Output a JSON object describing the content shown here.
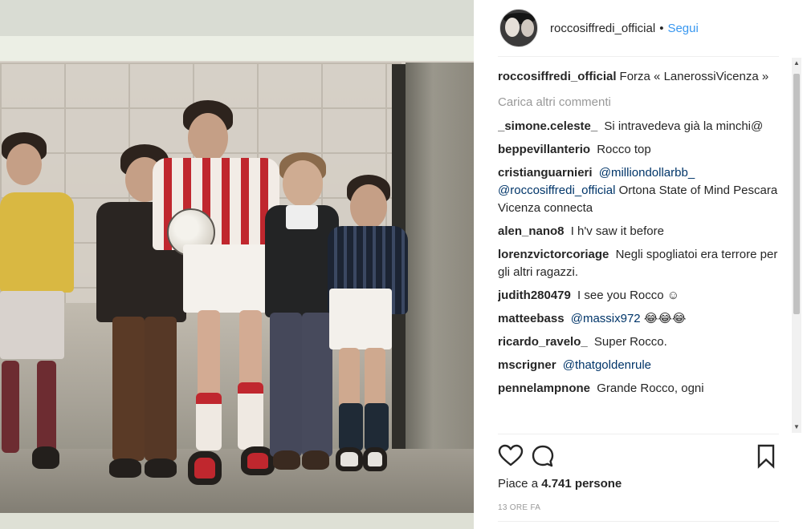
{
  "post": {
    "username": "roccosiffredi_official",
    "separator": "•",
    "follow_label": "Segui",
    "caption": {
      "user": "roccosiffredi_official",
      "text": "Forza « LanerossiVicenza »"
    },
    "load_more_label": "Carica altri commenti",
    "comments": [
      {
        "user": "_simone.celeste_",
        "text": "Si intravedeva già la minchi@"
      },
      {
        "user": "beppevillanterio",
        "text": "Rocco top"
      },
      {
        "user": "cristianguarnieri",
        "mention1": "@milliondollarbb_",
        "mention2": "@roccosiffredi_official",
        "text": "Ortona State of Mind Pescara Vicenza connecta"
      },
      {
        "user": "alen_nano8",
        "text": "I h'v saw it before"
      },
      {
        "user": "lorenzvictorcoriage",
        "text": "Negli spogliatoi era terrore per gli altri ragazzi."
      },
      {
        "user": "judith280479",
        "text": "I see you Rocco ☺"
      },
      {
        "user": "matteebass",
        "mention1": "@massix972",
        "text": "😂😂😂"
      },
      {
        "user": "ricardo_ravelo_",
        "text": "Super Rocco."
      },
      {
        "user": "mscrigner",
        "mention1": "@thatgoldenrule"
      },
      {
        "user": "pennelampnone",
        "text": "Grande Rocco, ogni"
      }
    ],
    "likes_text": "Piace a 4.741 persone",
    "likes_prefix": "Piace a ",
    "likes_count": "4.741 persone",
    "timestamp": "13 ORE FA"
  },
  "icons": {
    "like": "heart-icon",
    "comment": "comment-bubble-icon",
    "save": "bookmark-icon"
  },
  "colors": {
    "link_blue": "#3897f0",
    "mention": "#003569",
    "muted": "#999999",
    "text": "#262626"
  }
}
